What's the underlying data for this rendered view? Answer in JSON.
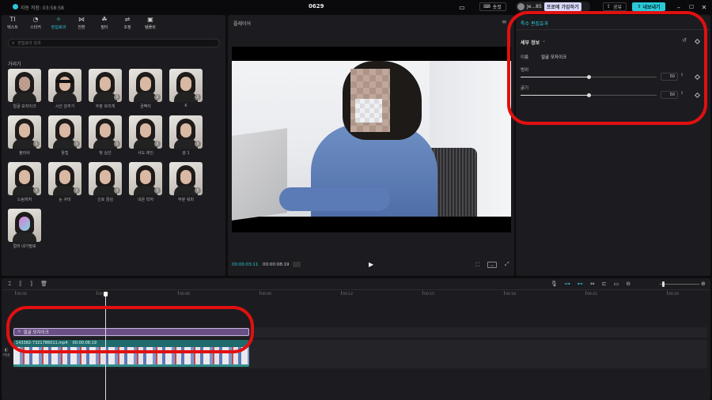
{
  "titlebar": {
    "autosave": "자동 저장: 03:58:58",
    "project_name": "0629",
    "shortcut_label": "숏컷",
    "user_name": "Je...85",
    "pro_label": "프로에 가입하기",
    "share_label": "공유",
    "export_label": "내보내기"
  },
  "toolbar": {
    "items": [
      {
        "icon": "TI",
        "label": "텍스트"
      },
      {
        "icon": "◔",
        "label": "스티커"
      },
      {
        "icon": "✧",
        "label": "편집효과"
      },
      {
        "icon": "⋈",
        "label": "전환"
      },
      {
        "icon": "☘",
        "label": "필터"
      },
      {
        "icon": "⇌",
        "label": "조정"
      },
      {
        "icon": "▣",
        "label": "템플릿"
      }
    ],
    "active_index": 2
  },
  "effects": {
    "search_placeholder": "편집효과 검색",
    "section_title": "가리기",
    "items": [
      {
        "label": "얼굴 모자이크",
        "badge": false
      },
      {
        "label": "시선 감추기",
        "badge": false
      },
      {
        "label": "부분 흐리게",
        "badge": true
      },
      {
        "label": "곰팩지",
        "badge": true
      },
      {
        "label": "K",
        "badge": true
      },
      {
        "label": "블러쉬",
        "badge": true
      },
      {
        "label": "톨팁",
        "badge": true
      },
      {
        "label": "빛 실선",
        "badge": true
      },
      {
        "label": "사도 레인",
        "badge": true
      },
      {
        "label": "광 1",
        "badge": true
      },
      {
        "label": "드림캐처",
        "badge": true
      },
      {
        "label": "눈 꾸미",
        "badge": true
      },
      {
        "label": "신호 끊김",
        "badge": true
      },
      {
        "label": "네온 빅처",
        "badge": true
      },
      {
        "label": "부분 워피",
        "badge": true
      },
      {
        "label": "컬러 네가필로",
        "badge": false
      }
    ]
  },
  "player": {
    "title": "플레이어",
    "current_time": "00:00:03:11",
    "total_time": "00:00:08:19"
  },
  "inspector": {
    "title": "특수 편집효과",
    "detail_label": "세부 정보",
    "name_key": "이름",
    "name_value": "얼굴 모자이크",
    "params": [
      {
        "label": "범위",
        "value": "50",
        "level": 0.5
      },
      {
        "label": "굵기",
        "value": "50",
        "level": 0.5
      }
    ]
  },
  "timeline": {
    "ruler": [
      "00:00",
      "00:03",
      "00:06",
      "00:09",
      "00:12",
      "00:15",
      "00:18",
      "00:21",
      "00:24"
    ],
    "effect_clip_label": "얼굴 모자이크",
    "video_clip_name": "143382-7321786011.mp4",
    "video_clip_duration": "00:00:08:19",
    "track_label": "커버"
  },
  "colors": {
    "accent": "#2bc8d8",
    "highlight": "#e11010",
    "effect_clip": "#6a4f86",
    "video_clip": "#1f6a6c"
  }
}
